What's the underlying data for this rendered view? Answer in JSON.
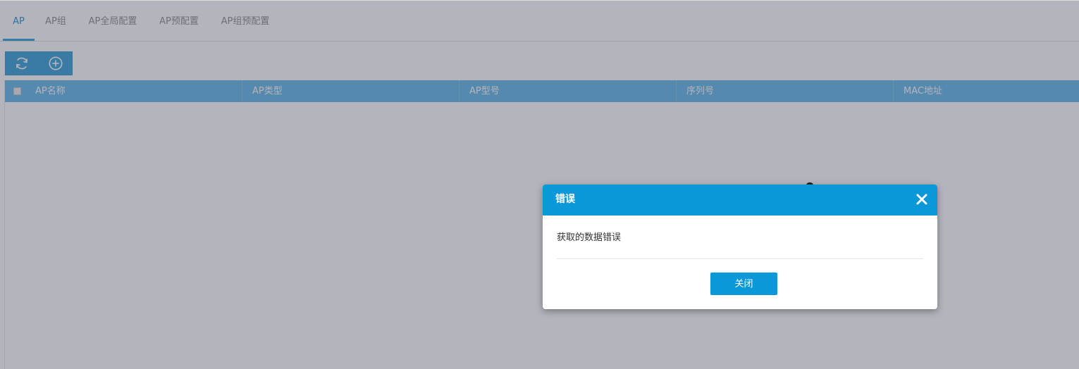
{
  "tabs": [
    {
      "label": "AP",
      "active": true
    },
    {
      "label": "AP组",
      "active": false
    },
    {
      "label": "AP全局配置",
      "active": false
    },
    {
      "label": "AP预配置",
      "active": false
    },
    {
      "label": "AP组预配置",
      "active": false
    }
  ],
  "toolbar": {
    "refresh_icon": "refresh-icon",
    "add_icon": "add-circle-icon"
  },
  "table": {
    "columns": [
      "AP名称",
      "AP类型",
      "AP型号",
      "序列号",
      "MAC地址"
    ],
    "rows": []
  },
  "modal": {
    "title": "错误",
    "message": "获取的数据错误",
    "close_button": "关闭",
    "close_icon": "close-icon"
  },
  "colors": {
    "accent": "#0b98d9",
    "header_bg": "#4eaee2",
    "overlay": "rgba(95,95,115,0.47)"
  }
}
